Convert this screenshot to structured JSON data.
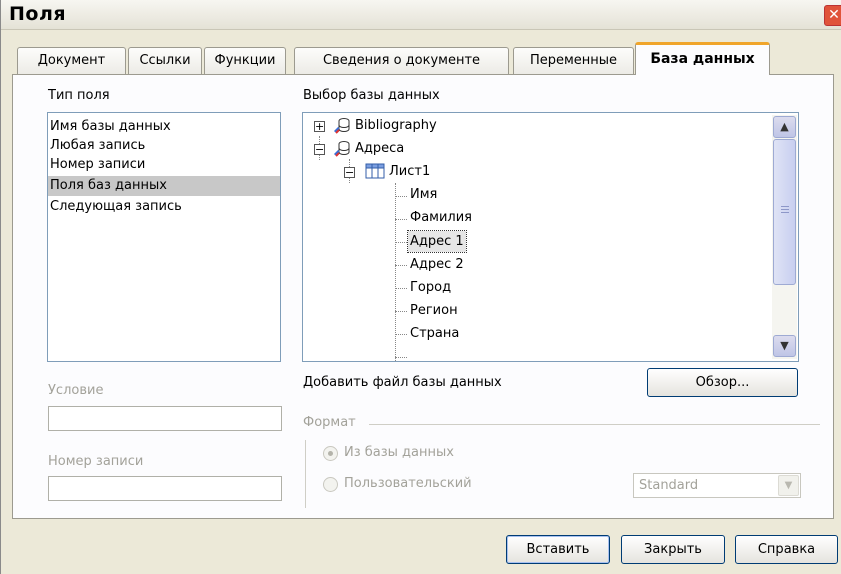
{
  "window": {
    "title": "Поля",
    "close_glyph": "✕"
  },
  "tabs": [
    {
      "label": "Документ"
    },
    {
      "label": "Ссылки"
    },
    {
      "label": "Функции"
    },
    {
      "label": "Сведения о документе"
    },
    {
      "label": "Переменные"
    },
    {
      "label": "База данных",
      "active": true
    }
  ],
  "field_type": {
    "label": "Тип поля",
    "items": [
      {
        "label": "Имя базы данных"
      },
      {
        "label": "Любая запись"
      },
      {
        "label": "Номер записи"
      },
      {
        "label": "Поля баз данных",
        "selected": true
      },
      {
        "label": "Следующая запись"
      }
    ]
  },
  "database_selection": {
    "label": "Выбор базы данных",
    "tree": {
      "db1": {
        "label": "Bibliography",
        "expanded": false
      },
      "db2": {
        "label": "Адреса",
        "expanded": true
      },
      "table": {
        "label": "Лист1",
        "expanded": true
      },
      "fields": [
        {
          "label": "Имя"
        },
        {
          "label": "Фамилия"
        },
        {
          "label": "Адрес 1",
          "selected": true
        },
        {
          "label": "Адрес 2"
        },
        {
          "label": "Город"
        },
        {
          "label": "Регион"
        },
        {
          "label": "Страна"
        }
      ]
    }
  },
  "condition": {
    "label": "Условие",
    "value": ""
  },
  "record_number": {
    "label": "Номер записи",
    "value": ""
  },
  "add_db_file": {
    "label": "Добавить файл базы данных",
    "browse_label": "Обзор..."
  },
  "format": {
    "label": "Формат",
    "from_db_label": "Из базы данных",
    "from_db_checked": true,
    "user_defined_label": "Пользовательский",
    "user_defined_checked": false,
    "format_value": "Standard"
  },
  "buttons": {
    "insert": "Вставить",
    "close": "Закрыть",
    "help": "Справка"
  },
  "colors": {
    "active_tab_accent": "#f0a52b",
    "window_bg": "#ece9d8",
    "selection_bg": "#c8c8c8"
  }
}
